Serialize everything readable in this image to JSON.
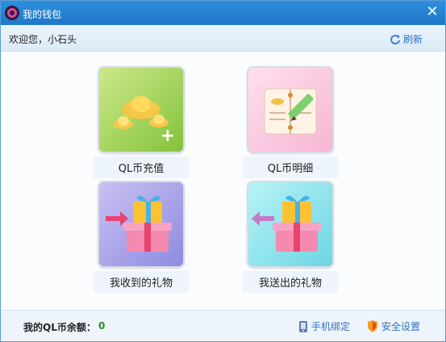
{
  "window": {
    "title": "我的钱包",
    "close_glyph": "✕"
  },
  "header": {
    "welcome": "欢迎您，小石头",
    "refresh_label": "刷新"
  },
  "tiles": [
    {
      "label": "QL币充值",
      "icon": "gold-ingot-plus-icon"
    },
    {
      "label": "QL币明细",
      "icon": "ledger-pencil-icon"
    },
    {
      "label": "我收到的礼物",
      "icon": "gift-received-icon"
    },
    {
      "label": "我送出的礼物",
      "icon": "gift-sent-icon"
    }
  ],
  "footer": {
    "balance_label": "我的QL币余额：",
    "balance_value": "0",
    "phone_bind_label": "手机绑定",
    "security_label": "安全设置"
  },
  "colors": {
    "accent": "#2e72c4",
    "titlebar": "#2f8fdc",
    "balance": "#2e8a2e"
  }
}
